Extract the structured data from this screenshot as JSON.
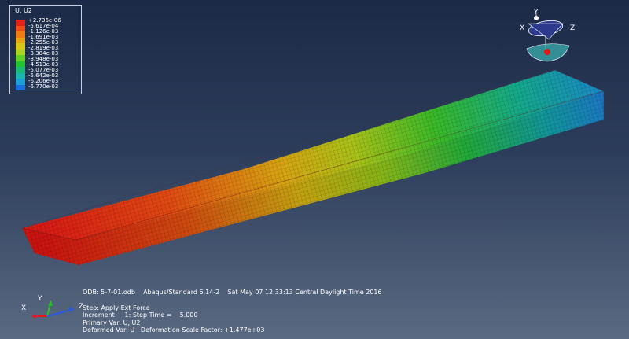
{
  "legend": {
    "title": "U, U2",
    "values": [
      "+2.736e-06",
      "-5.617e-04",
      "-1.126e-03",
      "-1.691e-03",
      "-2.255e-03",
      "-2.819e-03",
      "-3.384e-03",
      "-3.948e-03",
      "-4.513e-03",
      "-5.077e-03",
      "-5.642e-03",
      "-6.206e-03",
      "-6.770e-03"
    ],
    "colors": [
      "#e8201a",
      "#ee4b16",
      "#f07a14",
      "#e8a512",
      "#d6c914",
      "#aad41c",
      "#62cf22",
      "#22c431",
      "#1bb87a",
      "#18b6ad",
      "#1b9fd4",
      "#1c6fe0",
      "#2140e3"
    ]
  },
  "info": {
    "odb_line": "ODB: 5-7-01.odb    Abaqus/Standard 6.14-2    Sat May 07 12:33:13 Central Daylight Time 2016",
    "step": "Step: Apply Ext Force",
    "increment": "Increment     1: Step Time =    5.000",
    "primary_var": "Primary Var: U, U2",
    "deformed_var": "Deformed Var: U   Deformation Scale Factor: +1.477e+03"
  },
  "axes": {
    "x": "X",
    "y": "Y",
    "z": "Z"
  },
  "view_triad": {
    "x": "X",
    "y": "Y",
    "z": "Z"
  }
}
